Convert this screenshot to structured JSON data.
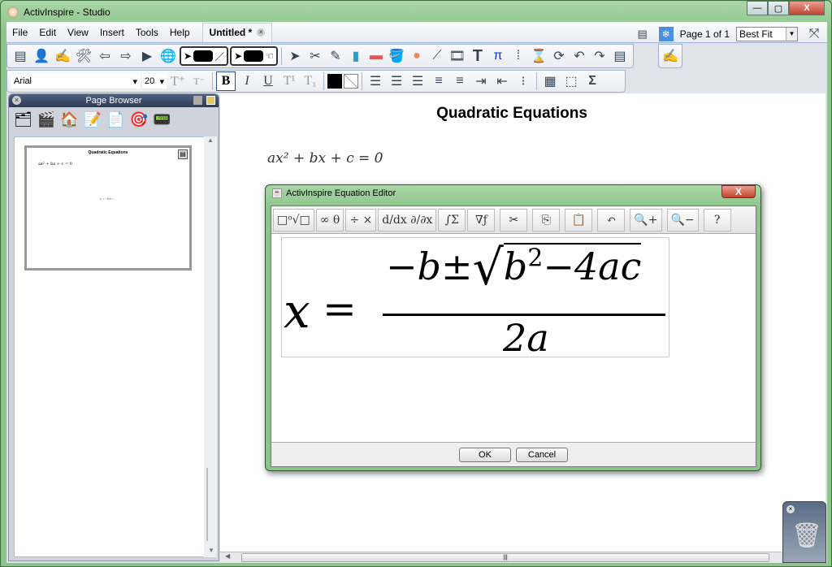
{
  "window": {
    "title": "ActivInspire - Studio",
    "minimize": "—",
    "maximize": "▢",
    "close": "X"
  },
  "menu": [
    "File",
    "Edit",
    "View",
    "Insert",
    "Tools",
    "Help"
  ],
  "doc_tab": {
    "label": "Untitled *"
  },
  "page_indicator": "Page 1 of 1",
  "zoom_select": "Best Fit",
  "main_toolbar": [
    "page-properties-icon",
    "user-profile-icon",
    "signature-icon",
    "desktop-tools-icon",
    "previous-page-icon",
    "next-page-icon",
    "play-icon",
    "browser-icon"
  ],
  "tools_toolbar": [
    "select-icon",
    "tools-icon",
    "pen-icon",
    "highlighter-icon",
    "eraser-icon",
    "fill-icon",
    "shape-icon",
    "connector-icon",
    "resource-icon",
    "text-icon",
    "pi-icon",
    "dot-matrix-icon",
    "clear-icon",
    "reset-icon",
    "undo-icon",
    "redo-icon",
    "page-icon"
  ],
  "format": {
    "font": "Arial",
    "size": "20",
    "bold": "B",
    "italic": "I",
    "underline": "U",
    "superscript": "T¹",
    "subscript": "T₁",
    "sigma": "Σ",
    "text_color": "#000000"
  },
  "page_browser": {
    "title": "Page Browser",
    "thumb_title": "Quadratic Equations",
    "thumb_eq": "ax² + bx + c = 0"
  },
  "canvas": {
    "title": "Quadratic Equations",
    "equation": "ax² + bx + c = 0"
  },
  "equation_editor": {
    "title": "ActivInspire Equation Editor",
    "tools": [
      "□ᵒ√□",
      "∞ θ",
      "÷ ×",
      "d/dx ∂/∂x",
      "∫Σ",
      "∇ƒ",
      "✂",
      "⎘",
      "📋",
      "↶",
      "🔍+",
      "🔍−",
      "?"
    ],
    "formula": {
      "lhs": "x",
      "eq": "=",
      "num_prefix": "−b±",
      "radicand_b": "b",
      "exp": "2",
      "radicand_rest": "−4ac",
      "den": "2a"
    },
    "ok": "OK",
    "cancel": "Cancel"
  }
}
